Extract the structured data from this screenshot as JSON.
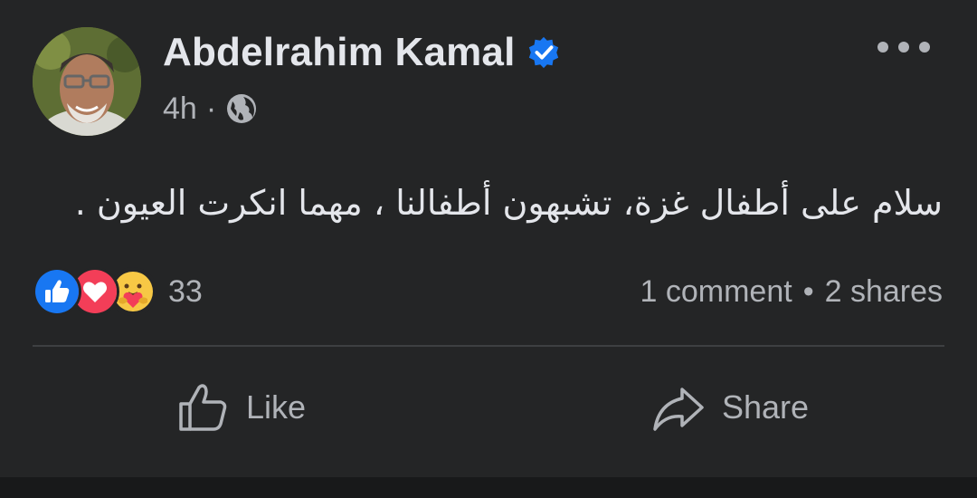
{
  "post": {
    "author": "Abdelrahim Kamal",
    "time": "4h",
    "separator": "·",
    "audience_icon": "globe-icon",
    "text": "سلام على أطفال غزة،  تشبهون أطفالنا ، مهما انكرت العيون .",
    "reaction_icons": [
      "like-reaction-icon",
      "love-reaction-icon",
      "care-reaction-icon"
    ],
    "reaction_count": "33",
    "comments": "1 comment",
    "stats_separator": "•",
    "shares": "2 shares"
  },
  "actions": {
    "like_label": "Like",
    "share_label": "Share"
  },
  "colors": {
    "background": "#242526",
    "primary_text": "#e4e6eb",
    "secondary_text": "#b0b3b8",
    "verified_blue": "#1877f2",
    "like_blue": "#1877f2",
    "love_red": "#f33e58"
  }
}
